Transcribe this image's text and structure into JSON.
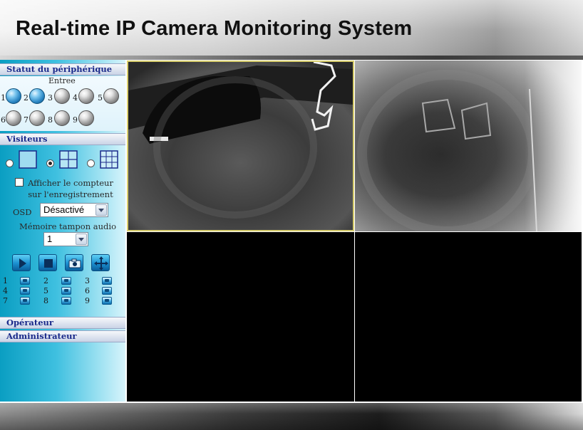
{
  "header": {
    "title": "Real-time IP Camera Monitoring System"
  },
  "sidebar": {
    "device_status": {
      "header": "Statut du périphérique",
      "input_label": "Entree",
      "leds": [
        {
          "num": "1",
          "state": "on"
        },
        {
          "num": "2",
          "state": "on"
        },
        {
          "num": "3",
          "state": "off"
        },
        {
          "num": "4",
          "state": "off"
        },
        {
          "num": "5",
          "state": "off"
        },
        {
          "num": "6",
          "state": "off"
        },
        {
          "num": "7",
          "state": "off"
        },
        {
          "num": "8",
          "state": "off"
        },
        {
          "num": "9",
          "state": "off"
        }
      ]
    },
    "visitors": {
      "header": "Visiteurs",
      "layouts": [
        {
          "name": "1x1",
          "checked": false
        },
        {
          "name": "2x2",
          "checked": true
        },
        {
          "name": "3x3",
          "checked": false
        }
      ],
      "record_counter_label": "Afficher le compteur sur l'enregistrement",
      "record_counter_checked": false,
      "osd_label": "OSD",
      "osd_value": "Désactivé",
      "audio_buffer_label": "Mémoire tampon audio",
      "audio_buffer_value": "1",
      "controls": [
        {
          "name": "play",
          "icon": "play-icon"
        },
        {
          "name": "stop",
          "icon": "stop-icon"
        },
        {
          "name": "snapshot",
          "icon": "camera-icon"
        },
        {
          "name": "ptz",
          "icon": "move-icon"
        }
      ],
      "cameras": [
        "1",
        "2",
        "3",
        "4",
        "5",
        "6",
        "7",
        "8",
        "9"
      ]
    },
    "operator": {
      "header": "Opérateur"
    },
    "administrator": {
      "header": "Administrateur"
    }
  },
  "colors": {
    "accent_blue": "#1a2a8a",
    "sidebar_cyan": "#3fc0e0",
    "selected_border": "#d9cf6e"
  }
}
